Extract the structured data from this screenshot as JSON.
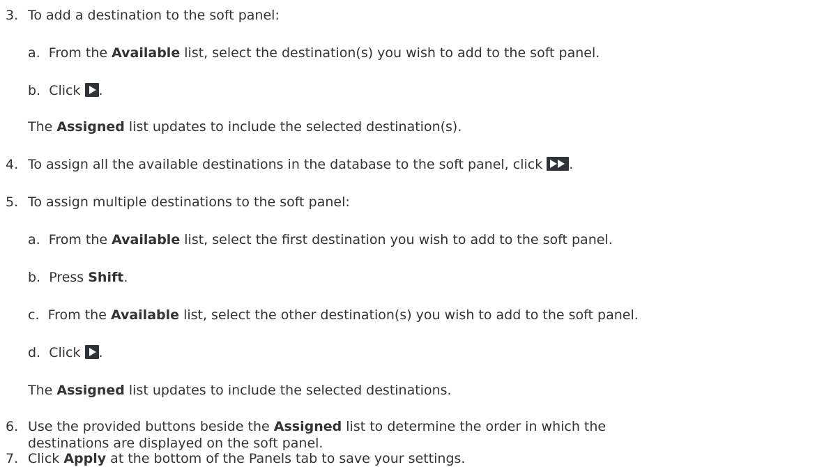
{
  "steps": {
    "s3": {
      "num": "3.",
      "text": "To add a destination to the soft panel:",
      "a": {
        "label": "a.",
        "pre": "From the ",
        "bold": "Available",
        "post": " list, select the destination(s) you wish to add to the soft panel."
      },
      "b": {
        "label": "b.",
        "pre": "Click ",
        "post": "."
      },
      "result": {
        "pre": "The ",
        "bold": "Assigned",
        "post": " list updates to include the selected destination(s)."
      }
    },
    "s4": {
      "num": "4.",
      "pre": "To assign all the available destinations in the database to the soft panel, click ",
      "post": "."
    },
    "s5": {
      "num": "5.",
      "text": "To assign multiple destinations to the soft panel:",
      "a": {
        "label": "a.",
        "pre": "From the ",
        "bold": "Available",
        "post": " list, select the first destination you wish to add to the soft panel."
      },
      "b": {
        "label": "b.",
        "pre": "Press ",
        "bold": "Shift",
        "post": "."
      },
      "c": {
        "label": "c.",
        "pre": "From the ",
        "bold": "Available",
        "post": " list, select the other destination(s) you wish to add to the soft panel."
      },
      "d": {
        "label": "d.",
        "pre": "Click ",
        "post": "."
      },
      "result": {
        "pre": "The ",
        "bold": "Assigned",
        "post": " list updates to include the selected destinations."
      }
    },
    "s6": {
      "num": "6.",
      "line1_pre": "Use the provided buttons beside the ",
      "line1_bold": "Assigned",
      "line1_post": " list to determine the order in which the",
      "line2": "destinations are displayed on the soft panel."
    },
    "s7": {
      "num": "7.",
      "pre": "Click ",
      "bold": "Apply",
      "post": " at the bottom of the Panels tab to save your settings."
    }
  },
  "icons": {
    "add": "play-right-icon",
    "add_all": "double-play-right-icon",
    "button_color": "#2f3236",
    "glyph_color": "#ffffff"
  }
}
